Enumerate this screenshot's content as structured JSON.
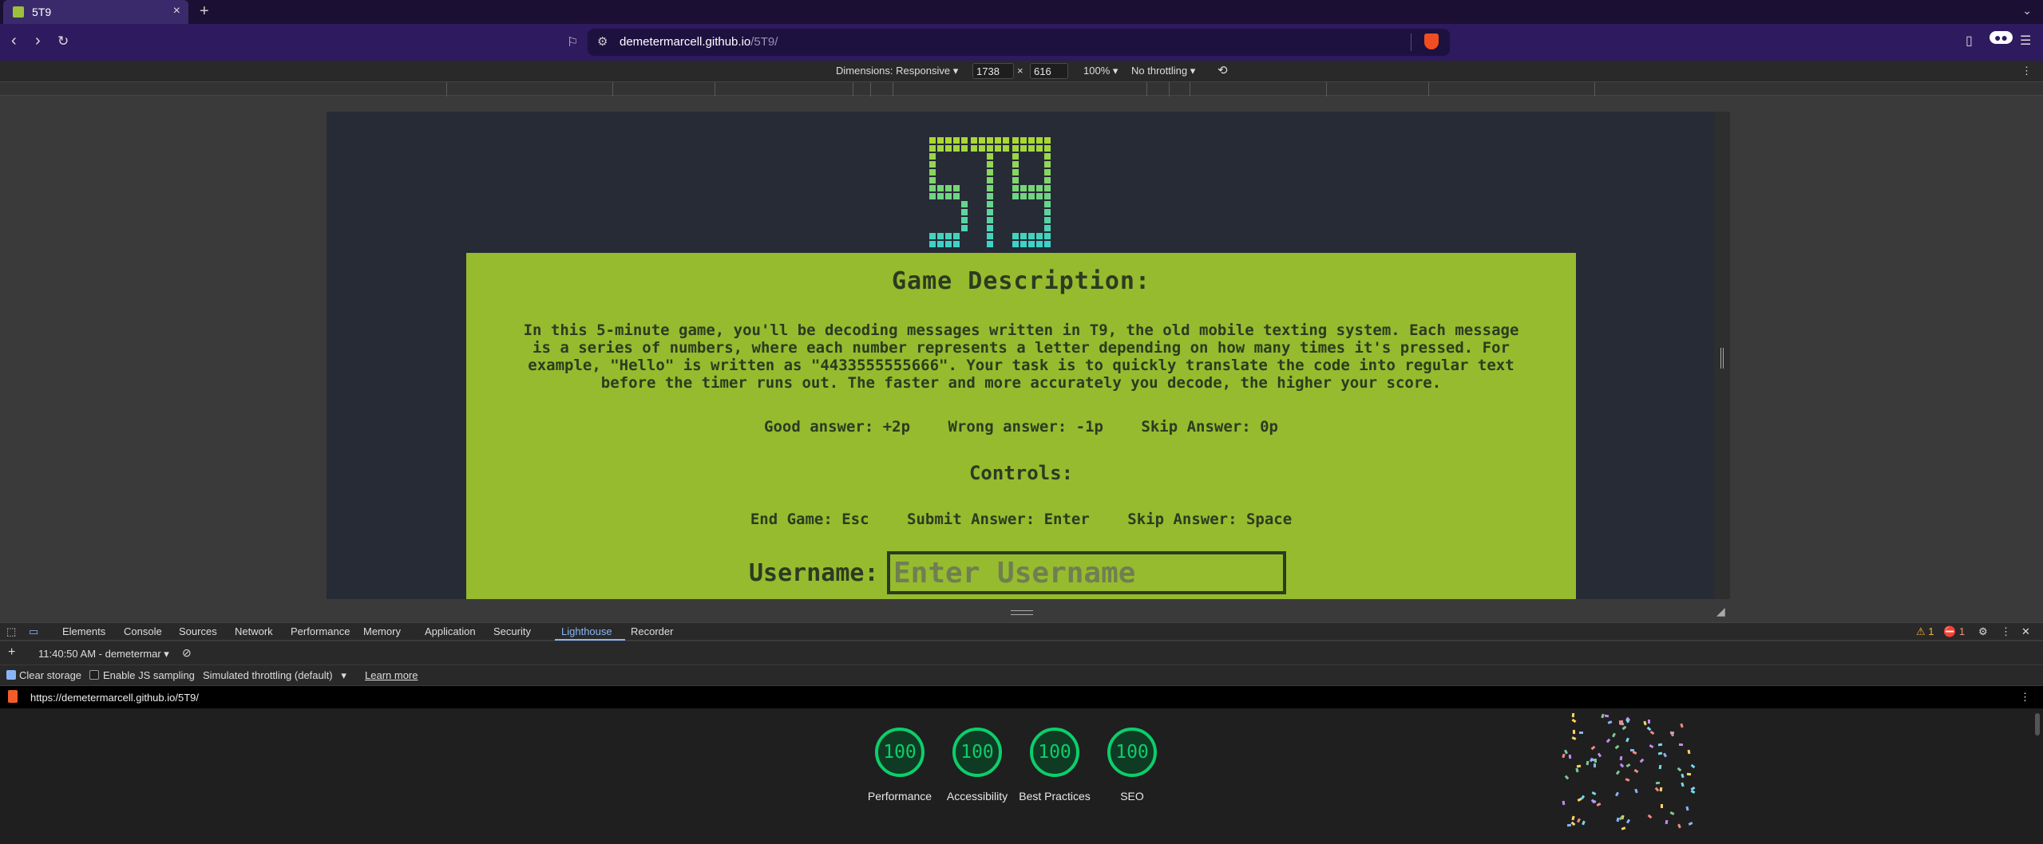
{
  "browser": {
    "tab_title": "5T9",
    "tab_close": "×",
    "new_tab": "+",
    "url_host": "demetermarcell.github.io",
    "url_path": "/5T9/"
  },
  "device_toolbar": {
    "dimensions_label": "Dimensions: Responsive",
    "width": "1738",
    "times": "×",
    "height": "616",
    "zoom": "100%",
    "throttling": "No throttling"
  },
  "game": {
    "logo_text": "5T9",
    "heading": "Game Description:",
    "description": "In this 5-minute game, you'll be decoding messages written in T9, the old mobile texting system. Each message is a series of numbers, where each number represents a letter depending on how many times it's pressed. For example, \"Hello\" is written as \"4433555555666\". Your task is to quickly translate the code into regular text before the timer runs out. The faster and more accurately you decode, the higher your score.",
    "scores": [
      "Good answer: +2p",
      "Wrong answer: -1p",
      "Skip Answer: 0p"
    ],
    "controls_heading": "Controls:",
    "controls": [
      "End Game: Esc",
      "Submit Answer: Enter",
      "Skip Answer: Space"
    ],
    "username_label": "Username:",
    "username_placeholder": "Enter Username",
    "username_value": ""
  },
  "devtools": {
    "tabs": [
      "Elements",
      "Console",
      "Sources",
      "Network",
      "Performance",
      "Memory",
      "Application",
      "Security",
      "Lighthouse",
      "Recorder"
    ],
    "active_tab": "Lighthouse",
    "warnings": "1",
    "errors": "1",
    "report_selector": "11:40:50 AM - demetermar",
    "clear_storage": "Clear storage",
    "enable_js_sampling": "Enable JS sampling",
    "throttling": "Simulated throttling (default)",
    "learn_more": "Learn more",
    "report_url": "https://demetermarcell.github.io/5T9/"
  },
  "lighthouse": {
    "scores": [
      {
        "label": "Performance",
        "value": "100"
      },
      {
        "label": "Accessibility",
        "value": "100"
      },
      {
        "label": "Best Practices",
        "value": "100"
      },
      {
        "label": "SEO",
        "value": "100"
      }
    ],
    "score_color": "#0cce6b"
  },
  "colors": {
    "panel_bg": "#96bb2e",
    "page_bg": "#262b36",
    "browser_frame": "#2e1a5e"
  }
}
